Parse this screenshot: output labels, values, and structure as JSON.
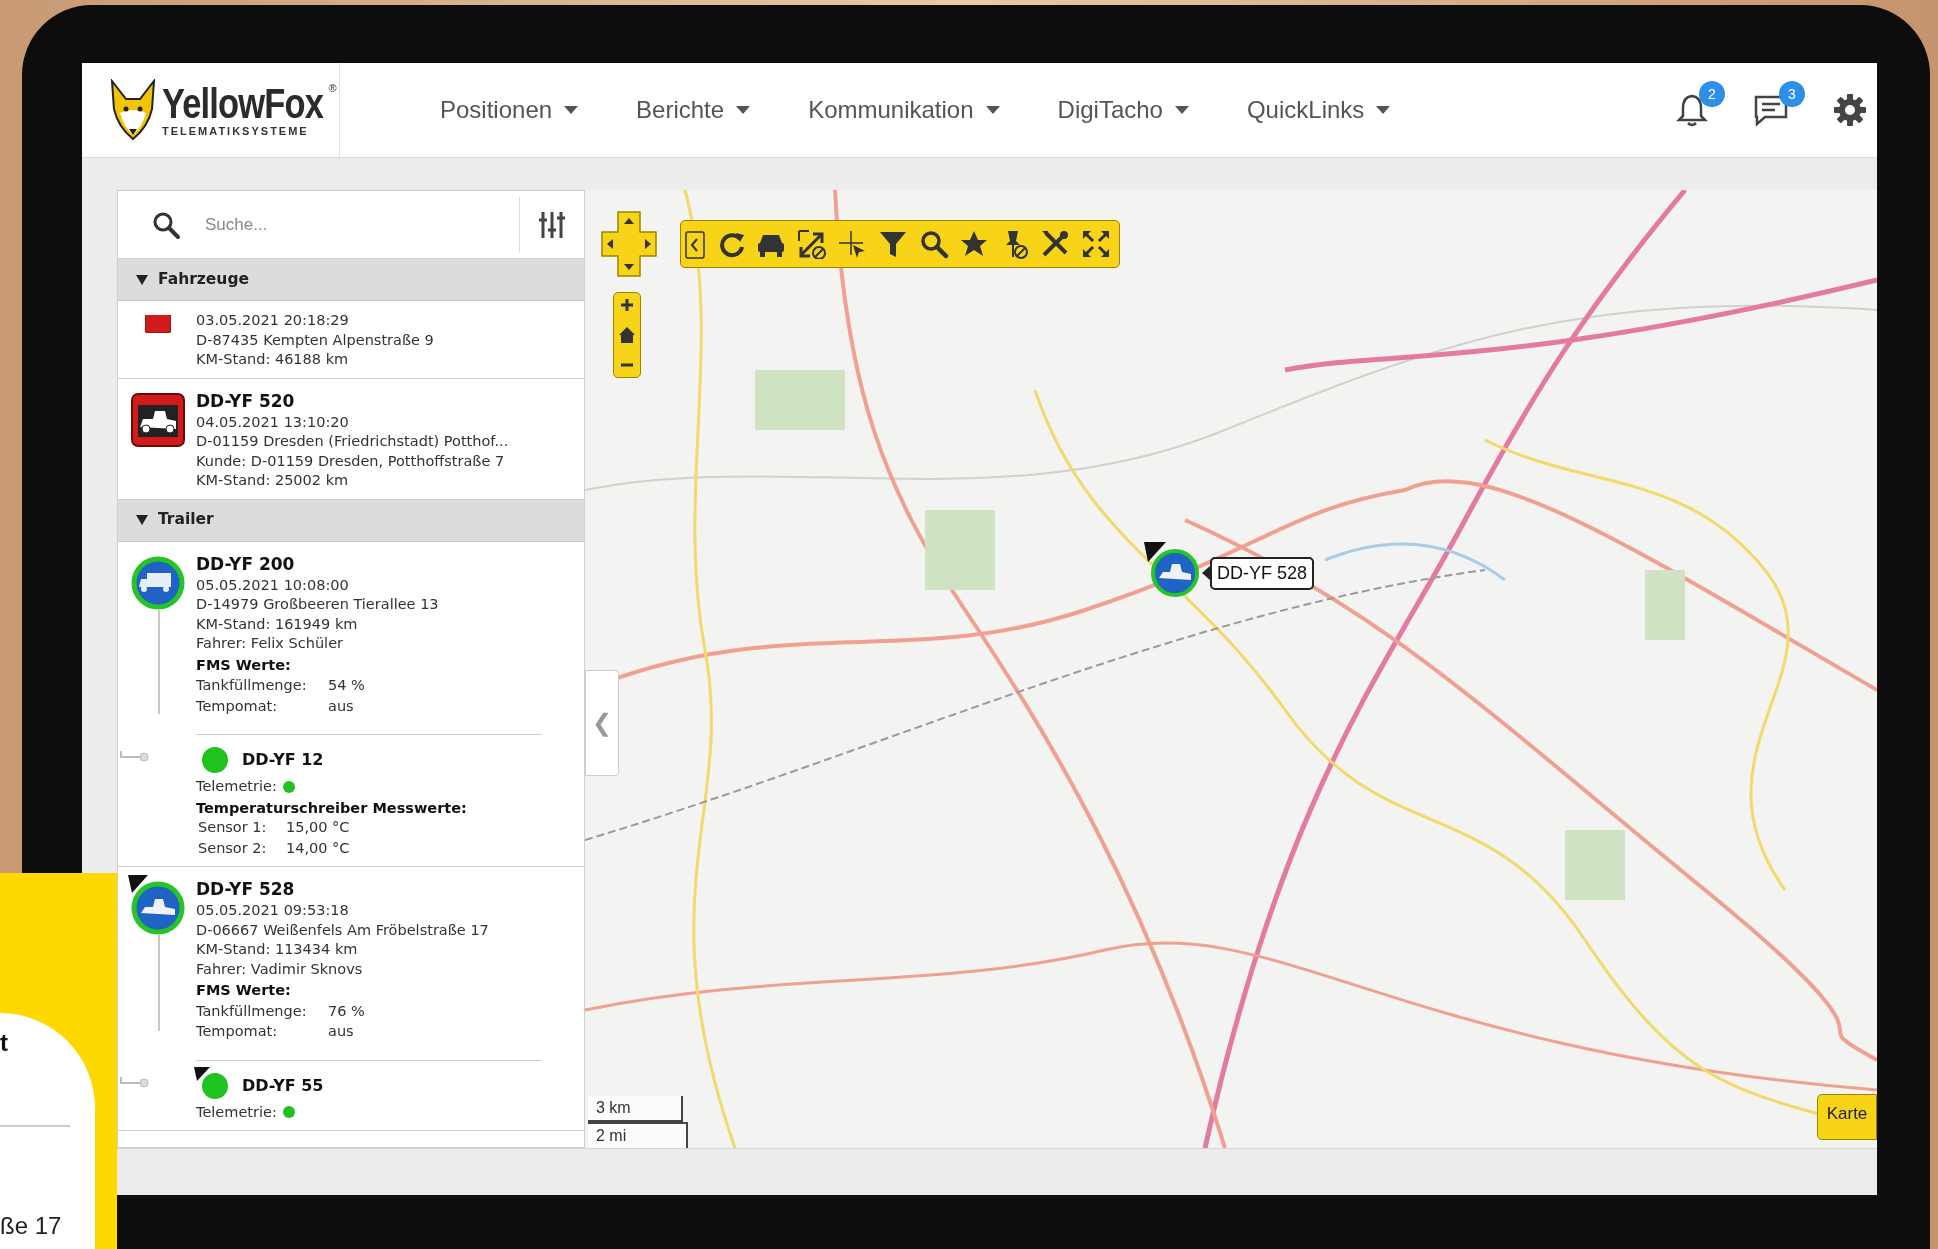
{
  "header": {
    "logo": {
      "name": "YellowFox",
      "mark": "®",
      "tagline": "TELEMATIKSYSTEME"
    },
    "nav": [
      {
        "label": "Positionen"
      },
      {
        "label": "Berichte"
      },
      {
        "label": "Kommunikation"
      },
      {
        "label": "DigiTacho"
      },
      {
        "label": "QuickLinks"
      }
    ],
    "actions": [
      {
        "kind": "bell",
        "badge": "2"
      },
      {
        "kind": "chat",
        "badge": "3"
      },
      {
        "kind": "gear"
      }
    ]
  },
  "sidebar": {
    "search": {
      "placeholder": "Suche..."
    },
    "groups": [
      {
        "title": "Fahrzeuge",
        "expanded": true,
        "items": [
          {
            "kind": "red-square",
            "lines": [
              "03.05.2021 20:18:29",
              "D-87435 Kempten Alpenstraße 9",
              "KM-Stand: 46188 km"
            ]
          },
          {
            "kind": "red-vehicle",
            "name": "DD-YF 520",
            "lines": [
              "04.05.2021 13:10:20",
              "D-01159 Dresden (Friedrichstadt) Potthof...",
              "Kunde: D-01159 Dresden, Potthoffstraße 7",
              "KM-Stand: 25002 km"
            ]
          }
        ]
      },
      {
        "title": "Trailer",
        "expanded": true,
        "items": [
          {
            "kind": "blue-truck",
            "name": "DD-YF 200",
            "heading": false,
            "lines": [
              "05.05.2021 10:08:00",
              "D-14979 Großbeeren Tierallee 13",
              "KM-Stand: 161949 km",
              "Fahrer: Felix Schüler"
            ],
            "fms": {
              "title": "FMS Werte:",
              "rows": [
                {
                  "label": "Tankfüllmenge:",
                  "value": "54 %"
                },
                {
                  "label": "Tempomat:",
                  "value": "aus"
                }
              ]
            },
            "children": [
              {
                "name": "DD-YF 12",
                "heading": false,
                "color": "#1fc21f",
                "telemetry": {
                  "label": "Telemetrie:",
                  "color": "#1fc21f"
                },
                "measurements": {
                  "title": "Temperaturschreiber Messwerte:",
                  "rows": [
                    {
                      "label": "Sensor 1:",
                      "value": "15,00 °C"
                    },
                    {
                      "label": "Sensor 2:",
                      "value": "14,00 °C"
                    }
                  ]
                }
              }
            ]
          },
          {
            "kind": "blue-vehicle",
            "name": "DD-YF 528",
            "heading": true,
            "lines": [
              "05.05.2021 09:53:18",
              "D-06667 Weißenfels Am Fröbelstraße 17",
              "KM-Stand: 113434 km",
              "Fahrer: Vadimir Sknovs"
            ],
            "fms": {
              "title": "FMS Werte:",
              "rows": [
                {
                  "label": "Tankfüllmenge:",
                  "value": "76 %"
                },
                {
                  "label": "Tempomat:",
                  "value": "aus"
                }
              ]
            },
            "children": [
              {
                "name": "DD-YF 55",
                "heading": true,
                "color": "#1fc21f",
                "telemetry": {
                  "label": "Telemetrie:",
                  "color": "#1fc21f"
                }
              }
            ]
          }
        ]
      }
    ]
  },
  "map": {
    "collapse": "❮",
    "marker": {
      "label": "DD-YF 528",
      "heading": true
    },
    "scale": [
      "3 km",
      "2 mi"
    ],
    "layer_button": "Karte"
  },
  "overlay_card": {
    "texts": [
      "t",
      "ße 17"
    ]
  }
}
